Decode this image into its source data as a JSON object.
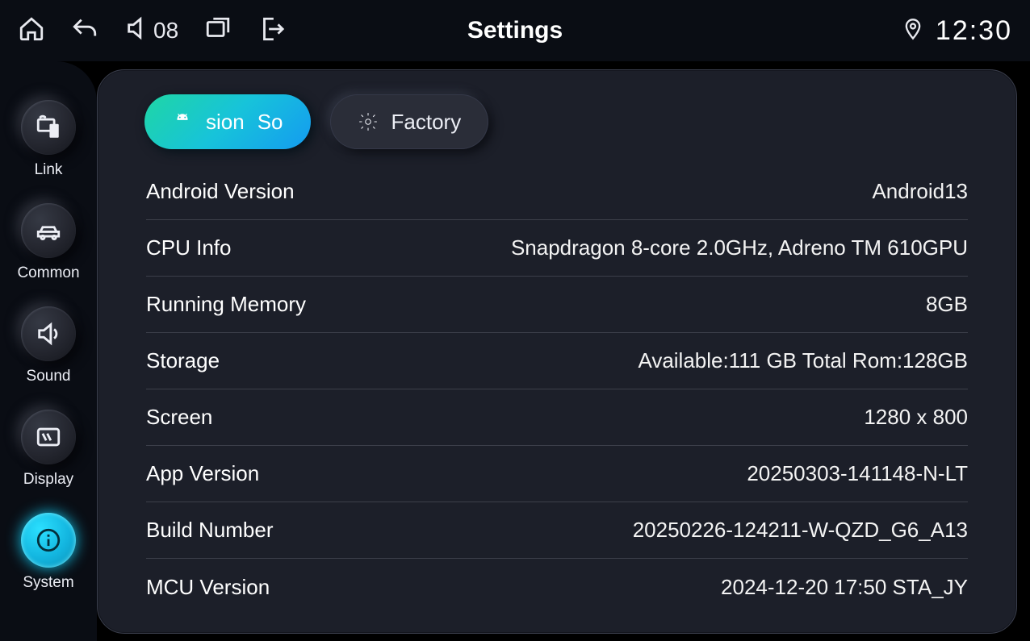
{
  "statusbar": {
    "title": "Settings",
    "volume": "08",
    "time": "12:30"
  },
  "sidebar": {
    "items": [
      {
        "id": "link",
        "label": "Link"
      },
      {
        "id": "common",
        "label": "Common"
      },
      {
        "id": "sound",
        "label": "Sound"
      },
      {
        "id": "display",
        "label": "Display"
      },
      {
        "id": "system",
        "label": "System"
      }
    ]
  },
  "tabs": {
    "active_primary": "sion",
    "active_secondary": "So",
    "factory": "Factory"
  },
  "info": [
    {
      "label": "Android Version",
      "value": "Android13"
    },
    {
      "label": "CPU Info",
      "value": "Snapdragon 8-core 2.0GHz, Adreno TM 610GPU"
    },
    {
      "label": "Running Memory",
      "value": "8GB"
    },
    {
      "label": "Storage",
      "value": "Available:111 GB Total Rom:128GB"
    },
    {
      "label": "Screen",
      "value": "1280 x 800"
    },
    {
      "label": "App Version",
      "value": "20250303-141148-N-LT"
    },
    {
      "label": "Build Number",
      "value": "20250226-124211-W-QZD_G6_A13"
    },
    {
      "label": "MCU Version",
      "value": "2024-12-20 17:50 STA_JY"
    }
  ]
}
